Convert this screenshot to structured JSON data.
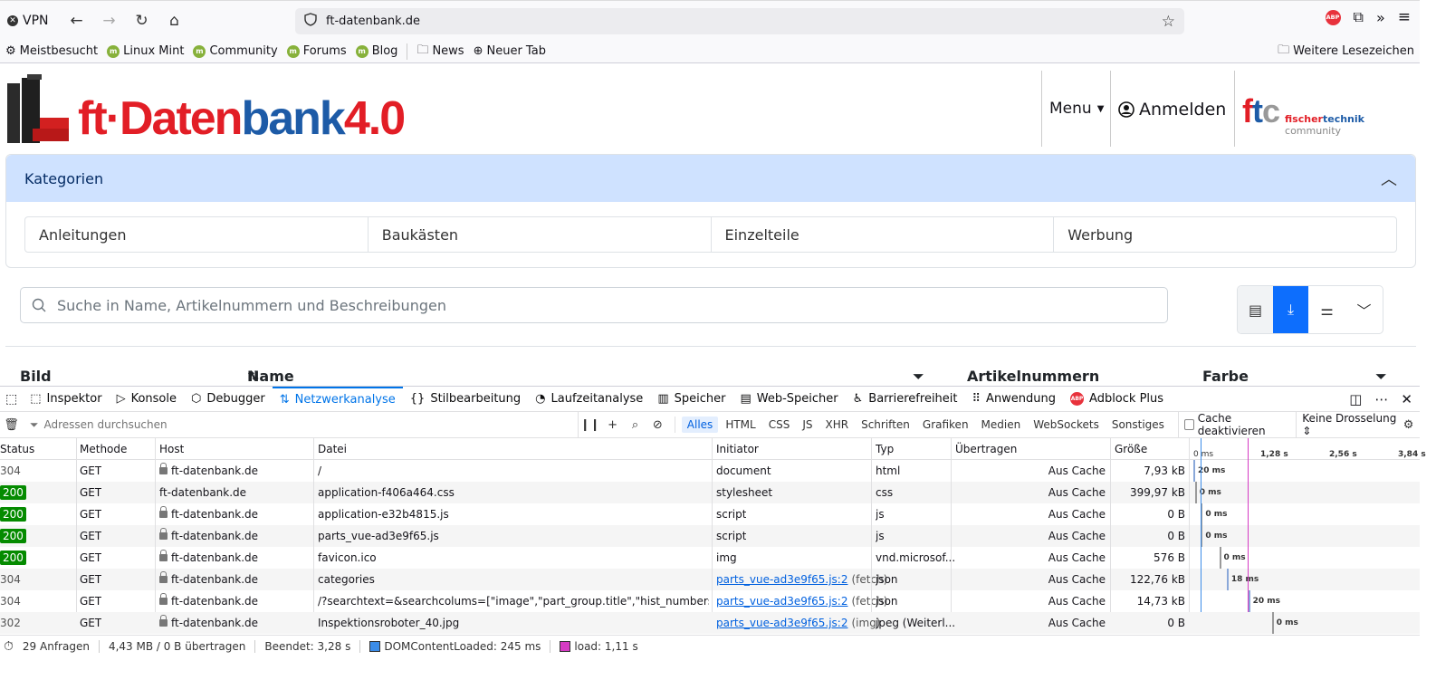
{
  "browser": {
    "vpn_label": "VPN",
    "url": "ft-datenbank.de",
    "bookmarks": [
      {
        "label": "Meistbesucht",
        "icon": "gear-icon"
      },
      {
        "label": "Linux Mint",
        "icon": "mint-icon"
      },
      {
        "label": "Community",
        "icon": "mint-icon"
      },
      {
        "label": "Forums",
        "icon": "mint-icon"
      },
      {
        "label": "Blog",
        "icon": "mint-icon"
      },
      {
        "label": "News",
        "icon": "folder-icon"
      },
      {
        "label": "Neuer Tab",
        "icon": "globe-icon"
      }
    ],
    "bookmarks_other": "Weitere Lesezeichen",
    "abp_badge": "ABP"
  },
  "site": {
    "logo_ft": "ft",
    "logo_dot": "·",
    "logo_daten": "Daten",
    "logo_bank": "bank",
    "logo_version": "4.0",
    "menu_label": "Menu",
    "login_label": "Anmelden",
    "ftc_f": "f",
    "ftc_t": "t",
    "ftc_c": "c",
    "ftc_fischer": "fischer",
    "ftc_technik": "technik",
    "ftc_community": "community",
    "categories_title": "Kategorien",
    "categories": [
      "Anleitungen",
      "Baukästen",
      "Einzelteile",
      "Werbung"
    ],
    "search_placeholder": "Suche in Name, Artikelnummern und Beschreibungen",
    "columns": {
      "bild": "Bild",
      "name": "Name",
      "artikelnummern": "Artikelnummern",
      "farbe": "Farbe"
    }
  },
  "devtools": {
    "tabs": [
      {
        "label": "Inspektor",
        "icon": "inspector-icon"
      },
      {
        "label": "Konsole",
        "icon": "console-icon"
      },
      {
        "label": "Debugger",
        "icon": "debugger-icon"
      },
      {
        "label": "Netzwerkanalyse",
        "icon": "network-icon",
        "active": true
      },
      {
        "label": "Stilbearbeitung",
        "icon": "style-editor-icon"
      },
      {
        "label": "Laufzeitanalyse",
        "icon": "performance-icon"
      },
      {
        "label": "Speicher",
        "icon": "memory-icon"
      },
      {
        "label": "Web-Speicher",
        "icon": "storage-icon"
      },
      {
        "label": "Barrierefreiheit",
        "icon": "accessibility-icon"
      },
      {
        "label": "Anwendung",
        "icon": "application-icon"
      },
      {
        "label": "Adblock Plus",
        "icon": "abp-icon"
      }
    ],
    "filter_placeholder": "Adressen durchsuchen",
    "type_filters": [
      "Alles",
      "HTML",
      "CSS",
      "JS",
      "XHR",
      "Schriften",
      "Grafiken",
      "Medien",
      "WebSockets",
      "Sonstiges"
    ],
    "active_filter": "Alles",
    "cache_label": "Cache deaktivieren",
    "throttle_label": "Keine Drosselung",
    "headers": {
      "status": "Status",
      "methode": "Methode",
      "host": "Host",
      "datei": "Datei",
      "initiator": "Initiator",
      "typ": "Typ",
      "uebertragen": "Übertragen",
      "groesse": "Größe"
    },
    "timeline_ticks": [
      "0 ms",
      "1,28 s",
      "2,56 s",
      "3,84 s"
    ],
    "requests": [
      {
        "status": "304",
        "method": "GET",
        "host": "ft-datenbank.de",
        "secure": true,
        "file": "/",
        "initiator": "document",
        "initiator_link": false,
        "type": "html",
        "transferred": "Aus Cache",
        "size": "7,93 kB",
        "time": "20 ms",
        "start": 0.0,
        "dur": 0.02
      },
      {
        "status": "200",
        "method": "GET",
        "host": "ft-datenbank.de",
        "secure": false,
        "file": "application-f406a464.css",
        "initiator": "stylesheet",
        "initiator_link": false,
        "type": "css",
        "transferred": "Aus Cache",
        "size": "399,97 kB",
        "time": "0 ms",
        "start": 0.03,
        "dur": 0
      },
      {
        "status": "200",
        "method": "GET",
        "host": "ft-datenbank.de",
        "secure": true,
        "file": "application-e32b4815.js",
        "initiator": "script",
        "initiator_link": false,
        "type": "js",
        "transferred": "Aus Cache",
        "size": "0 B",
        "time": "0 ms",
        "start": 0.14,
        "dur": 0
      },
      {
        "status": "200",
        "method": "GET",
        "host": "ft-datenbank.de",
        "secure": true,
        "file": "parts_vue-ad3e9f65.js",
        "initiator": "script",
        "initiator_link": false,
        "type": "js",
        "transferred": "Aus Cache",
        "size": "0 B",
        "time": "0 ms",
        "start": 0.14,
        "dur": 0
      },
      {
        "status": "200",
        "method": "GET",
        "host": "ft-datenbank.de",
        "secure": true,
        "file": "favicon.ico",
        "initiator": "img",
        "initiator_link": false,
        "type": "vnd.microsof...",
        "transferred": "Aus Cache",
        "size": "576 B",
        "time": "0 ms",
        "start": 0.48,
        "dur": 0
      },
      {
        "status": "304",
        "method": "GET",
        "host": "ft-datenbank.de",
        "secure": true,
        "file": "categories",
        "initiator": "parts_vue-ad3e9f65.js:2",
        "initiator_suffix": "(fetch)",
        "initiator_link": true,
        "type": "json",
        "transferred": "Aus Cache",
        "size": "122,76 kB",
        "time": "18 ms",
        "start": 0.62,
        "dur": 0.018
      },
      {
        "status": "304",
        "method": "GET",
        "host": "ft-datenbank.de",
        "secure": true,
        "file": "/?searchtext=&searchcolums=[\"image\",\"part_group.title\",\"hist_numbers\",\"colors\",\"my",
        "initiator": "parts_vue-ad3e9f65.js:2",
        "initiator_suffix": "(fetch)",
        "initiator_link": true,
        "type": "json",
        "transferred": "Aus Cache",
        "size": "14,73 kB",
        "time": "20 ms",
        "start": 1.02,
        "dur": 0.02
      },
      {
        "status": "302",
        "method": "GET",
        "host": "ft-datenbank.de",
        "secure": true,
        "file": "Inspektionsroboter_40.jpg",
        "initiator": "parts_vue-ad3e9f65.js:2",
        "initiator_suffix": "(img)",
        "initiator_link": true,
        "type": "jpeg (Weiterl...",
        "transferred": "Aus Cache",
        "size": "0 B",
        "time": "0 ms",
        "start": 1.46,
        "dur": 0
      }
    ],
    "status_bar": {
      "requests": "29 Anfragen",
      "transferred": "4,43 MB / 0 B übertragen",
      "finished": "Beendet: 3,28 s",
      "dom_loaded": "DOMContentLoaded: 245 ms",
      "load": "load: 1,11 s"
    },
    "colors": {
      "dom_loaded": "#3b8ce8",
      "load": "#d63bc4",
      "status_ok": "#058b00",
      "accent": "#0074e8"
    }
  }
}
